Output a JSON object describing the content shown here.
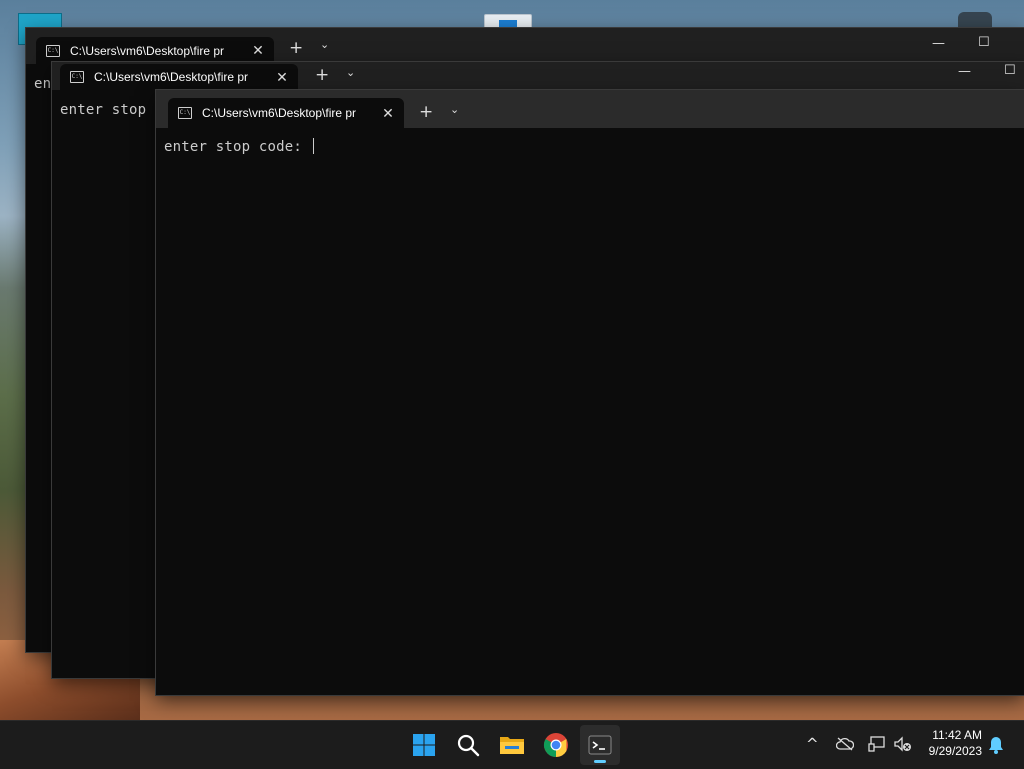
{
  "desktop": {
    "icons": [
      "app-icon",
      "window-icon",
      "gauge-icon"
    ]
  },
  "windows": [
    {
      "tab_title": "C:\\Users\\vm6\\Desktop\\fire pr",
      "content": "en",
      "new_tab": "+",
      "dropdown": "⌄"
    },
    {
      "tab_title": "C:\\Users\\vm6\\Desktop\\fire pr",
      "content": "enter stop",
      "new_tab": "+",
      "dropdown": "⌄"
    },
    {
      "tab_title": "C:\\Users\\vm6\\Desktop\\fire pr",
      "content": "enter stop code: ",
      "new_tab": "+",
      "dropdown": "⌄"
    }
  ],
  "window_controls": {
    "minimize": "—",
    "maximize": "☐",
    "close_tab": "✕"
  },
  "taskbar": {
    "apps": [
      "start-icon",
      "search-icon",
      "file-explorer-icon",
      "chrome-icon",
      "terminal-icon"
    ],
    "active_app": "terminal-icon",
    "tray": {
      "chevron": "^",
      "time": "11:42 AM",
      "date": "9/29/2023"
    }
  },
  "colors": {
    "terminal_bg": "#0c0c0c",
    "titlebar_bg": "#202020",
    "taskbar_bg": "#1c1c1c",
    "accent": "#60cdff"
  }
}
